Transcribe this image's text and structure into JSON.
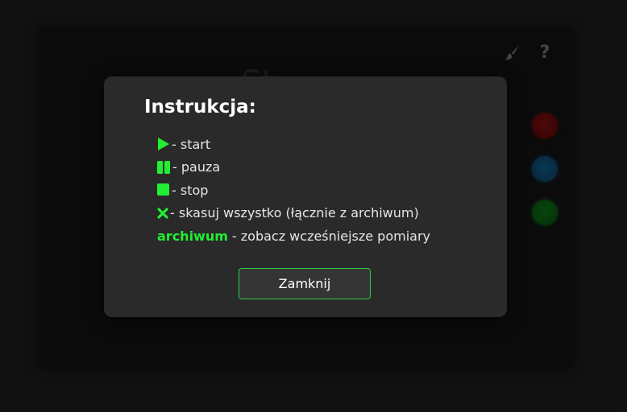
{
  "background_app": {
    "title": "St",
    "icons": [
      "brush-icon",
      "help-icon"
    ],
    "help_glyph": "?",
    "color_swatches": [
      {
        "name": "red",
        "color": "#6b0c0c"
      },
      {
        "name": "blue",
        "color": "#0d4a70"
      },
      {
        "name": "green",
        "color": "#0b6013"
      }
    ]
  },
  "modal": {
    "title": "Instrukcja:",
    "accent_color": "#22ee33",
    "items": [
      {
        "icon": "play-icon",
        "text": "- start"
      },
      {
        "icon": "pause-icon",
        "text": "- pauza"
      },
      {
        "icon": "stop-icon",
        "text": "- stop"
      },
      {
        "icon": "close-x-icon",
        "text": "- skasuj wszystko (łącznie z archiwum)"
      },
      {
        "keyword": "archiwum",
        "text": "- zobacz wcześniejsze pomiary"
      }
    ],
    "close_button_label": "Zamknij"
  }
}
